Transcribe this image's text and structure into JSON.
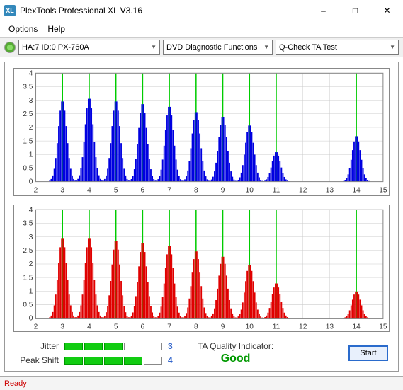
{
  "window": {
    "title": "PlexTools Professional XL V3.16"
  },
  "menu": {
    "options": "Options",
    "help": "Help"
  },
  "toolbar": {
    "drive": "HA:7 ID:0   PX-760A",
    "func": "DVD Diagnostic Functions",
    "test": "Q-Check TA Test"
  },
  "chart_data": [
    {
      "type": "bar",
      "color": "#0000e0",
      "xlabel": "",
      "ylabel": "",
      "xlim": [
        2,
        15
      ],
      "ylim": [
        0,
        4
      ],
      "xticks": [
        2,
        3,
        4,
        5,
        6,
        7,
        8,
        9,
        10,
        11,
        12,
        13,
        14,
        15
      ],
      "yticks": [
        0,
        0.5,
        1,
        1.5,
        2,
        2.5,
        3,
        3.5,
        4
      ],
      "markers": [
        3,
        4,
        5,
        6,
        7,
        8,
        9,
        10,
        11,
        14
      ],
      "peaks": [
        {
          "c": 3,
          "h": 3.0
        },
        {
          "c": 4,
          "h": 3.1
        },
        {
          "c": 5,
          "h": 3.0
        },
        {
          "c": 6,
          "h": 2.9
        },
        {
          "c": 7,
          "h": 2.8
        },
        {
          "c": 8,
          "h": 2.6
        },
        {
          "c": 9,
          "h": 2.4
        },
        {
          "c": 10,
          "h": 2.1
        },
        {
          "c": 11,
          "h": 1.1
        },
        {
          "c": 14,
          "h": 1.7
        }
      ]
    },
    {
      "type": "bar",
      "color": "#e00000",
      "xlabel": "",
      "ylabel": "",
      "xlim": [
        2,
        15
      ],
      "ylim": [
        0,
        4
      ],
      "xticks": [
        2,
        3,
        4,
        5,
        6,
        7,
        8,
        9,
        10,
        11,
        12,
        13,
        14,
        15
      ],
      "yticks": [
        0,
        0.5,
        1,
        1.5,
        2,
        2.5,
        3,
        3.5,
        4
      ],
      "markers": [
        3,
        4,
        5,
        6,
        7,
        8,
        9,
        10,
        11,
        14
      ],
      "peaks": [
        {
          "c": 3,
          "h": 3.0
        },
        {
          "c": 4,
          "h": 3.0
        },
        {
          "c": 5,
          "h": 2.9
        },
        {
          "c": 6,
          "h": 2.8
        },
        {
          "c": 7,
          "h": 2.7
        },
        {
          "c": 8,
          "h": 2.5
        },
        {
          "c": 9,
          "h": 2.3
        },
        {
          "c": 10,
          "h": 2.0
        },
        {
          "c": 11,
          "h": 1.3
        },
        {
          "c": 14,
          "h": 1.0
        }
      ]
    }
  ],
  "metrics": {
    "jitter_label": "Jitter",
    "jitter_value": "3",
    "jitter_filled": 3,
    "peakshift_label": "Peak Shift",
    "peakshift_value": "4",
    "peakshift_filled": 4,
    "ta_label": "TA Quality Indicator:",
    "ta_value": "Good",
    "start": "Start"
  },
  "status": "Ready"
}
